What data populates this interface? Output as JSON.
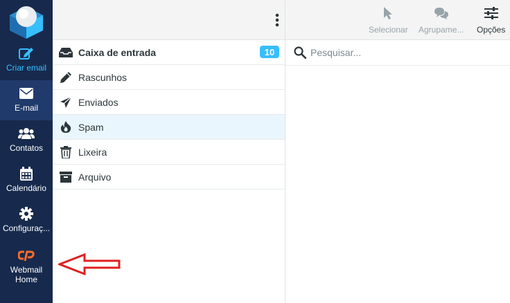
{
  "sidebar": {
    "compose": "Criar email",
    "mail": "E-mail",
    "contacts": "Contatos",
    "calendar": "Calendário",
    "settings": "Configuraç...",
    "webmail_line1": "Webmail",
    "webmail_line2": "Home"
  },
  "folders": [
    {
      "label": "Caixa de entrada",
      "badge": "10"
    },
    {
      "label": "Rascunhos"
    },
    {
      "label": "Enviados"
    },
    {
      "label": "Spam"
    },
    {
      "label": "Lixeira"
    },
    {
      "label": "Arquivo"
    }
  ],
  "toolbar": {
    "select": "Selecionar",
    "group": "Agrupame...",
    "options": "Opções"
  },
  "search": {
    "placeholder": "Pesquisar..."
  },
  "colors": {
    "sidebar_bg": "#172a4d",
    "accent": "#37beff",
    "cpanel_orange": "#ff6c2c",
    "annotation_red": "#e02020"
  }
}
